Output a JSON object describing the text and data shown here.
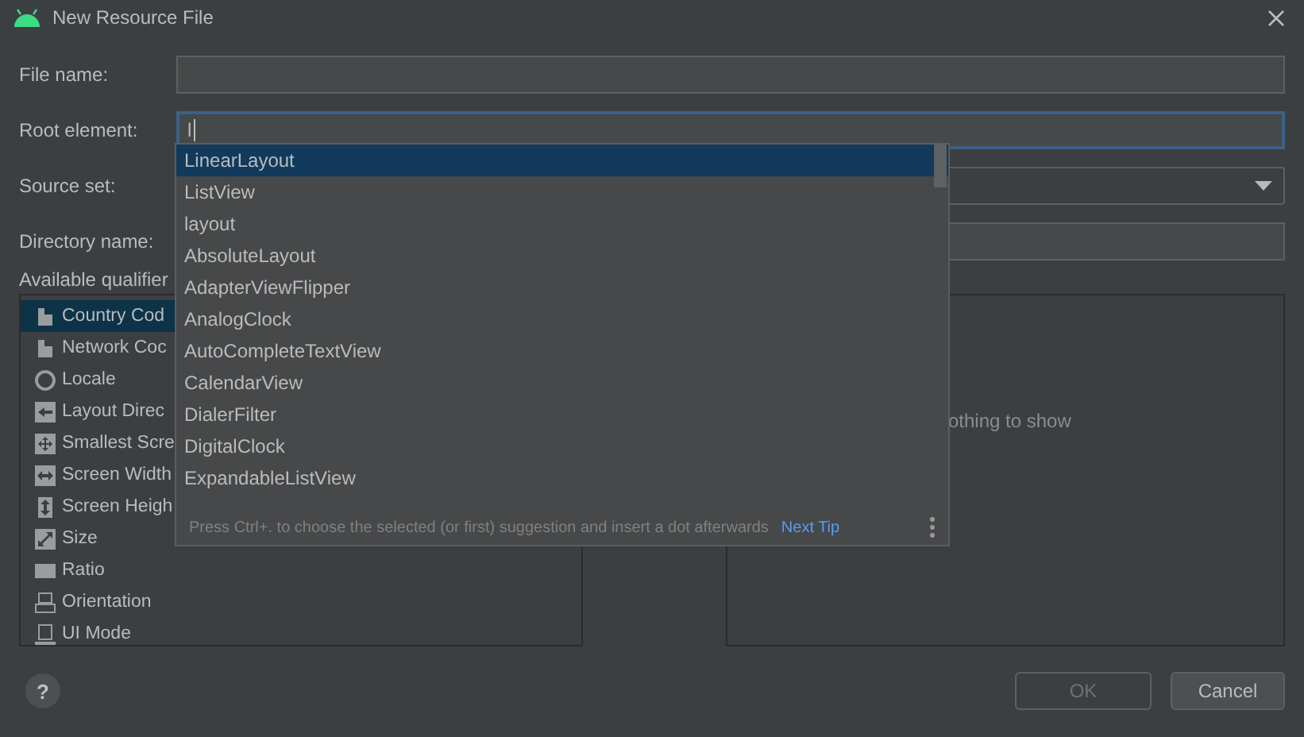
{
  "window": {
    "title": "New Resource File"
  },
  "fields": [
    {
      "label": "File name:",
      "kind": "text",
      "focused": false
    },
    {
      "label": "Root element:",
      "kind": "text",
      "value": "l",
      "focused": true
    },
    {
      "label": "Source set:",
      "kind": "dropdown",
      "focused": false
    },
    {
      "label": "Directory name:",
      "kind": "text",
      "focused": false
    }
  ],
  "qualifiers": {
    "label": "Available qualifier",
    "items": [
      {
        "label": "Country Cod",
        "selected": true
      },
      {
        "label": "Network Coc",
        "selected": false
      },
      {
        "label": "Locale",
        "selected": false
      },
      {
        "label": "Layout Direc",
        "selected": false
      },
      {
        "label": "Smallest Scre",
        "selected": false
      },
      {
        "label": "Screen Width",
        "selected": false
      },
      {
        "label": "Screen Heigh",
        "selected": false
      },
      {
        "label": "Size",
        "selected": false
      },
      {
        "label": "Ratio",
        "selected": false
      },
      {
        "label": "Orientation",
        "selected": false
      },
      {
        "label": "UI Mode",
        "selected": false
      }
    ]
  },
  "chosen": {
    "empty_text": "othing to show"
  },
  "suggestions": {
    "items": [
      {
        "label": "LinearLayout",
        "selected": true
      },
      {
        "label": "ListView",
        "selected": false
      },
      {
        "label": "layout",
        "selected": false
      },
      {
        "label": "AbsoluteLayout",
        "selected": false
      },
      {
        "label": "AdapterViewFlipper",
        "selected": false
      },
      {
        "label": "AnalogClock",
        "selected": false
      },
      {
        "label": "AutoCompleteTextView",
        "selected": false
      },
      {
        "label": "CalendarView",
        "selected": false
      },
      {
        "label": "DialerFilter",
        "selected": false
      },
      {
        "label": "DigitalClock",
        "selected": false
      },
      {
        "label": "ExpandableListView",
        "selected": false
      }
    ],
    "hint": "Press Ctrl+. to choose the selected (or first) suggestion and insert a dot afterwards",
    "link": "Next Tip"
  },
  "help": "?",
  "buttons": [
    {
      "label": "OK",
      "disabled": true
    },
    {
      "label": "Cancel",
      "disabled": false
    }
  ]
}
